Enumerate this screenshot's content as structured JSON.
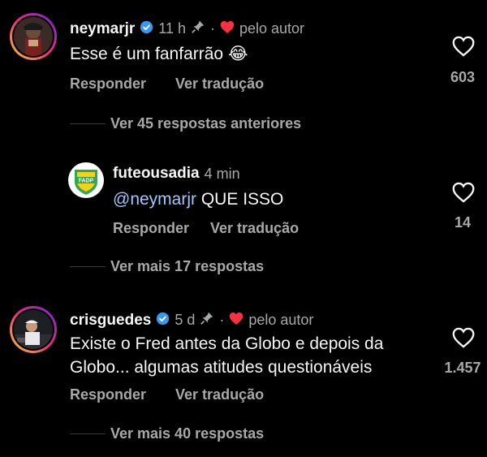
{
  "comments": [
    {
      "username": "neymarjr",
      "time": "11 h",
      "separator": "·",
      "by_author": "pelo autor",
      "text": "Esse é um fanfarrão",
      "emoji": "😂",
      "reply_label": "Responder",
      "translate_label": "Ver tradução",
      "likes": "603",
      "view_replies": "Ver 45 respostas anteriores"
    },
    {
      "username": "futeousadia",
      "time": "4 min",
      "mention": "@neymarjr",
      "text": " QUE ISSO",
      "reply_label": "Responder",
      "translate_label": "Ver tradução",
      "likes": "14",
      "view_replies": "Ver mais 17 respostas"
    },
    {
      "username": "crisguedes",
      "time": "5 d",
      "separator": "·",
      "by_author": "pelo autor",
      "text_line1": "Existe o Fred antes da Globo e depois da",
      "text_line2": "Globo... algumas atitudes questionáveis",
      "reply_label": "Responder",
      "translate_label": "Ver tradução",
      "likes": "1.457",
      "view_replies": "Ver mais 40 respostas"
    }
  ],
  "icons": {
    "verified": "verified-badge-icon",
    "pin": "pin-icon",
    "heart_red": "heart-filled-icon",
    "heart_outline": "heart-outline-icon"
  },
  "colors": {
    "background": "#000000",
    "verified": "#3897f0",
    "heart": "#ff3040",
    "mention": "#9fc6ff",
    "secondary_text": "#a8a8a8",
    "logo_green": "#2fa84f",
    "logo_yellow": "#f7d117"
  },
  "logo_text": "FADP"
}
